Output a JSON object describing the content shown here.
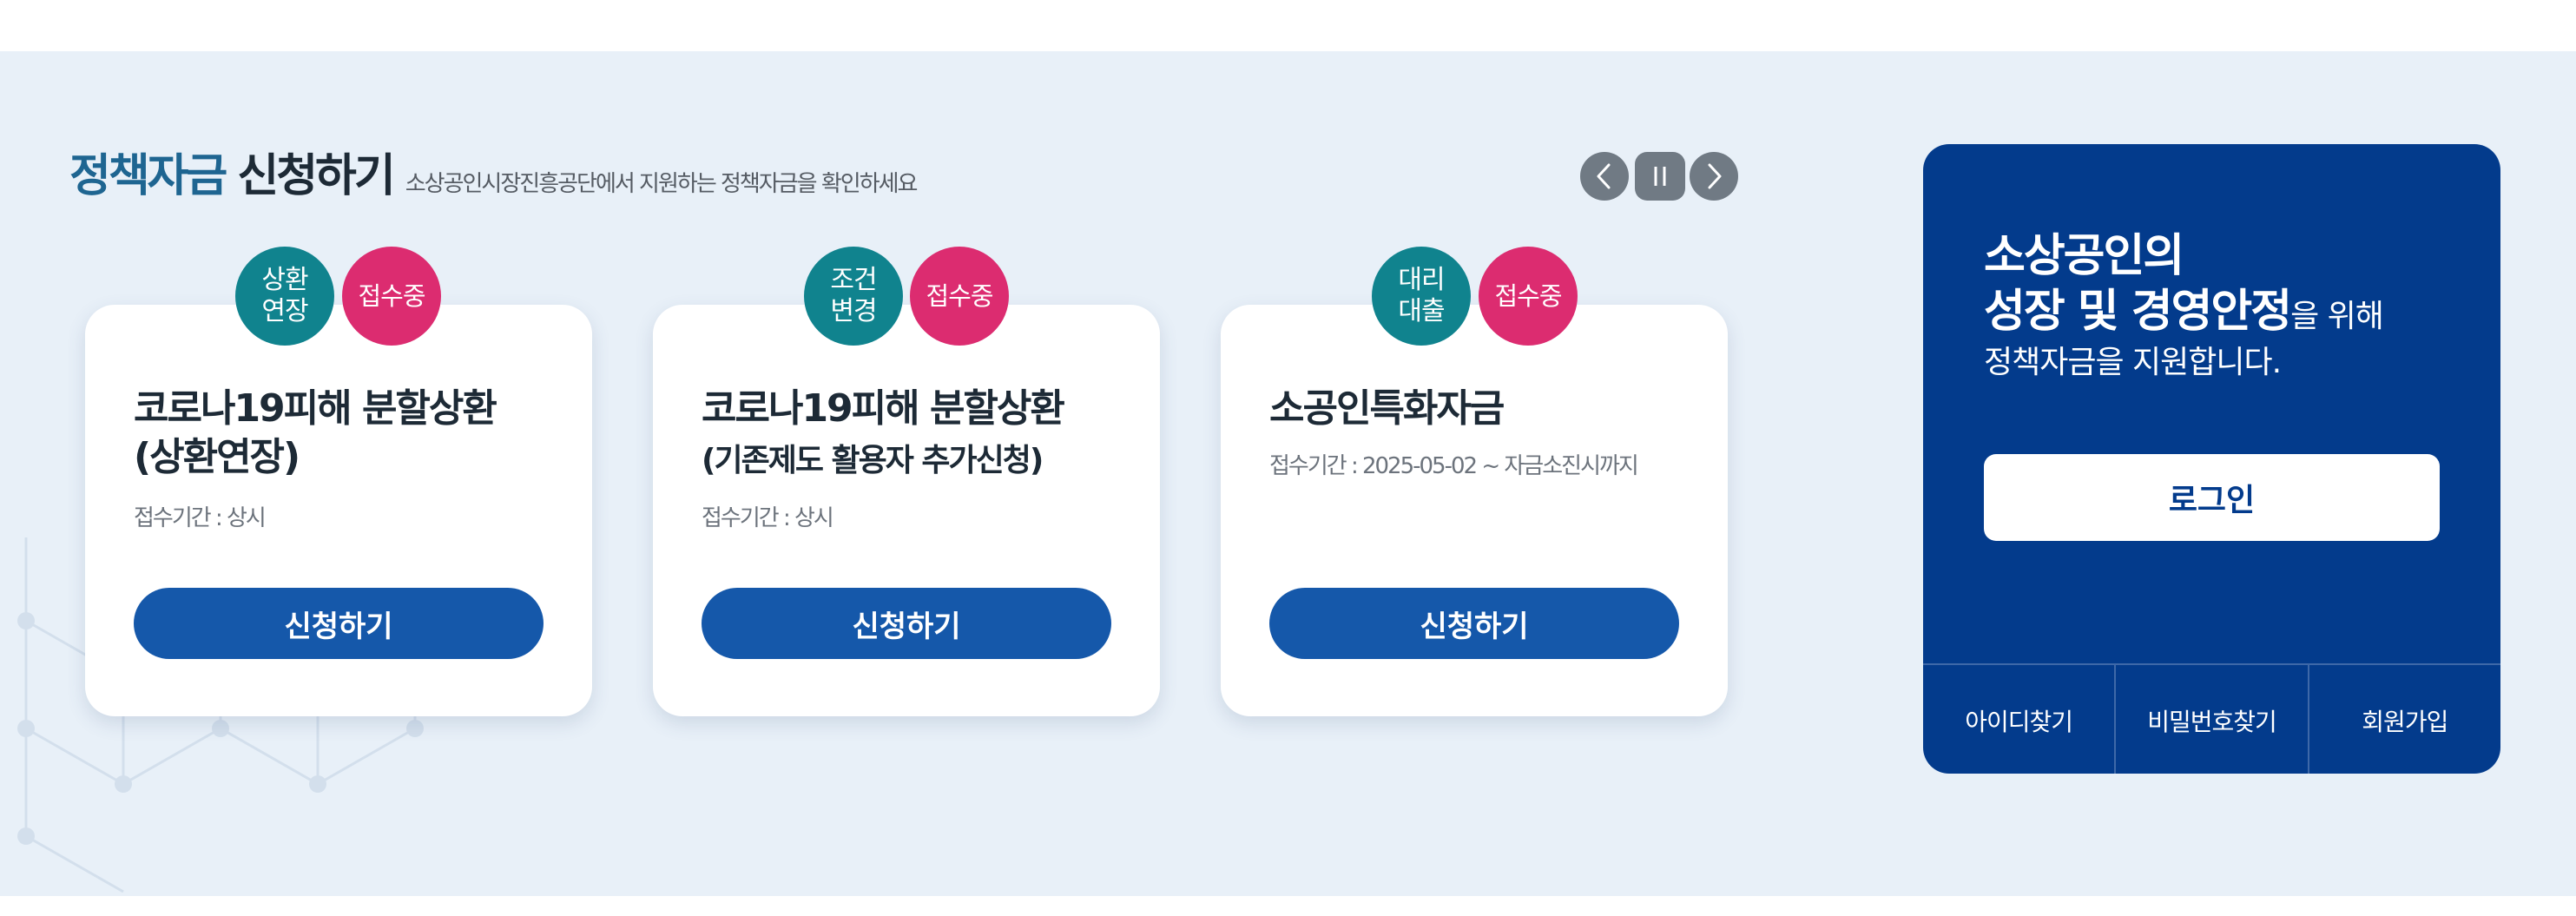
{
  "section": {
    "title_blue": "정책자금",
    "title_dark": "신청하기",
    "subtitle": "소상공인시장진흥공단에서 지원하는 정책자금을 확인하세요"
  },
  "slider": {
    "prev_icon": "chevron-left-icon",
    "pause_icon": "pause-icon",
    "next_icon": "chevron-right-icon"
  },
  "cards": [
    {
      "type_badge": [
        "상환",
        "연장"
      ],
      "status_badge": "접수중",
      "title_line1": "코로나19피해 분할상환",
      "title_line2": "(상환연장)",
      "period": "접수기간 : 상시",
      "button": "신청하기"
    },
    {
      "type_badge": [
        "조건",
        "변경"
      ],
      "status_badge": "접수중",
      "title_line1": "코로나19피해 분할상환",
      "title_line2": "(기존제도 활용자 추가신청)",
      "period": "접수기간 : 상시",
      "button": "신청하기"
    },
    {
      "type_badge": [
        "대리",
        "대출"
      ],
      "status_badge": "접수중",
      "title_line1": "소공인특화자금",
      "period": "접수기간 : 2025-05-02 ~ 자금소진시까지",
      "button": "신청하기"
    }
  ],
  "login_panel": {
    "line1": "소상공인의",
    "line2_strong": "성장 및 경영안정",
    "line2_weak": "을 위해",
    "line3": "정책자금을 지원합니다.",
    "login_button": "로그인",
    "links": [
      "아이디찾기",
      "비밀번호찾기",
      "회원가입"
    ]
  },
  "colors": {
    "background": "#e8f0f8",
    "title_blue": "#1e6591",
    "button_blue": "#1558aa",
    "badge_teal": "#10838e",
    "badge_pink": "#dc2c70",
    "panel_navy": "#033b8c"
  }
}
